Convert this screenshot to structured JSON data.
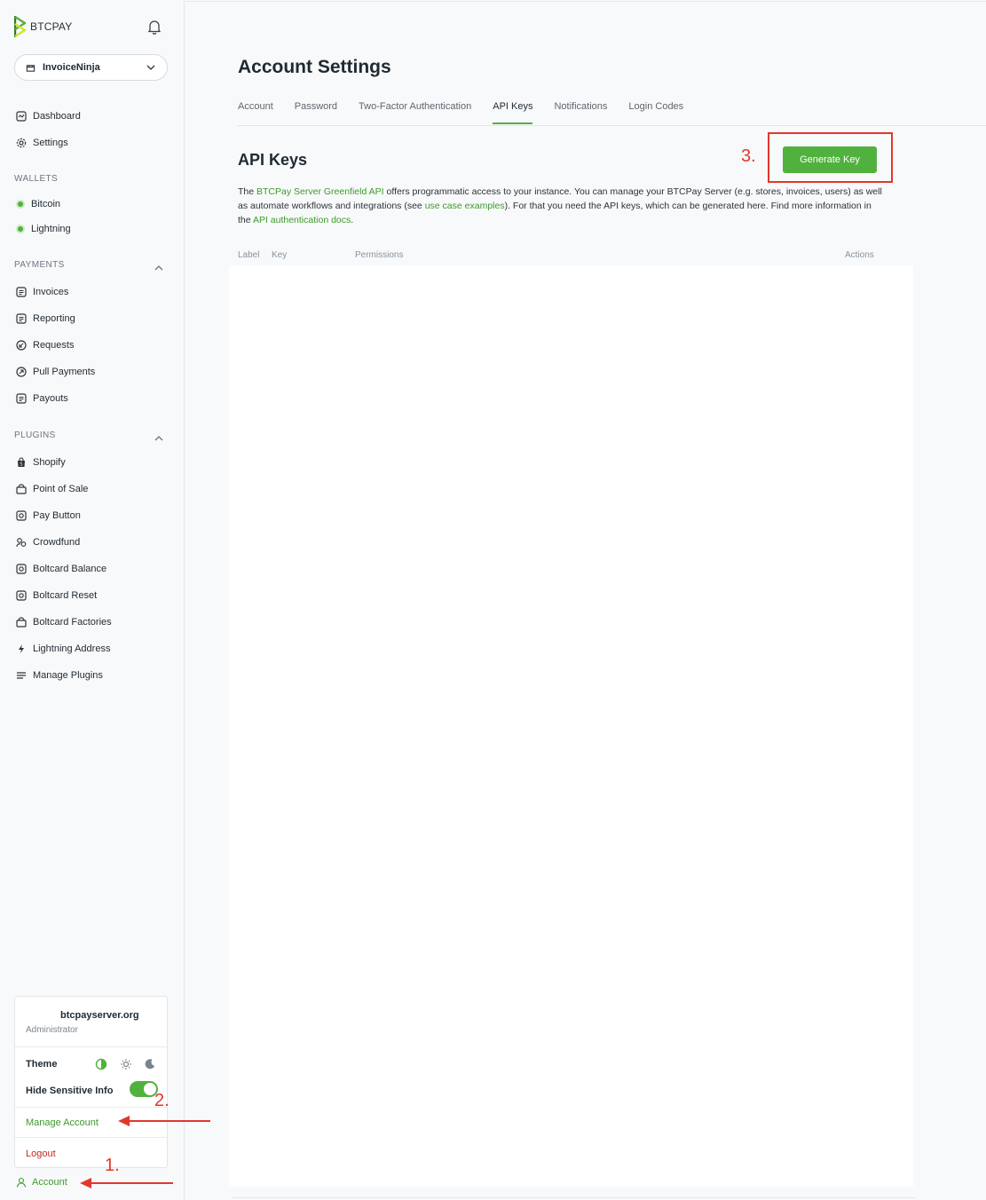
{
  "brand": {
    "name": "BTCPAY"
  },
  "store": {
    "name": "InvoiceNinja"
  },
  "nav": {
    "dashboard": "Dashboard",
    "settings": "Settings",
    "wallets_title": "WALLETS",
    "bitcoin": "Bitcoin",
    "lightning": "Lightning",
    "payments_title": "PAYMENTS",
    "invoices": "Invoices",
    "reporting": "Reporting",
    "requests": "Requests",
    "pull_payments": "Pull Payments",
    "payouts": "Payouts",
    "plugins_title": "PLUGINS",
    "shopify": "Shopify",
    "point_of_sale": "Point of Sale",
    "pay_button": "Pay Button",
    "crowdfund": "Crowdfund",
    "boltcard_balance": "Boltcard Balance",
    "boltcard_reset": "Boltcard Reset",
    "boltcard_factories": "Boltcard Factories",
    "lightning_address": "Lightning Address",
    "manage_plugins": "Manage Plugins"
  },
  "account_menu": {
    "org": "btcpayserver.org",
    "role": "Administrator",
    "theme_label": "Theme",
    "hide_sensitive_label": "Hide Sensitive Info",
    "hide_sensitive_on": true,
    "manage_account": "Manage Account",
    "logout": "Logout"
  },
  "account_link": "Account",
  "page": {
    "title": "Account Settings",
    "tabs": [
      "Account",
      "Password",
      "Two-Factor Authentication",
      "API Keys",
      "Notifications",
      "Login Codes"
    ],
    "active_tab": "API Keys",
    "section_title": "API Keys",
    "generate_button": "Generate Key",
    "desc_1": "The ",
    "desc_link_1": "BTCPay Server Greenfield API",
    "desc_2": " offers programmatic access to your instance. You can manage your BTCPay Server (e.g. stores, invoices, users) as well as automate workflows and integrations (see ",
    "desc_link_2": "use case examples",
    "desc_3": "). For that you need the API keys, which can be generated here. Find more information in the ",
    "desc_link_3": "API authentication docs",
    "desc_4": ".",
    "table_headers": {
      "label": "Label",
      "key": "Key",
      "permissions": "Permissions",
      "actions": "Actions"
    }
  },
  "annotations": {
    "step1": "1.",
    "step2": "2.",
    "step3": "3."
  },
  "colors": {
    "accent": "#51b13e",
    "annotation": "#e2372c",
    "danger": "#c62a23"
  }
}
